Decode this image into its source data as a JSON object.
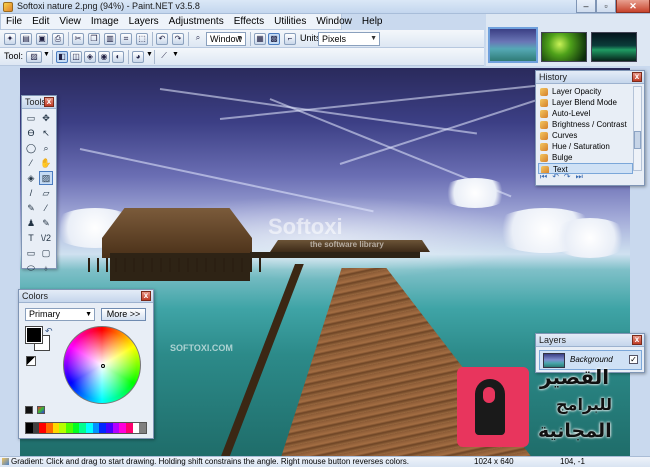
{
  "window": {
    "title": "Softoxi nature 2.png (94%) - Paint.NET v3.5.8",
    "minimize": "–",
    "maximize": "▫",
    "close": "✕"
  },
  "menu": [
    "File",
    "Edit",
    "View",
    "Image",
    "Layers",
    "Adjustments",
    "Effects",
    "Utilities",
    "Window",
    "Help"
  ],
  "toolbar": {
    "zoom_value": "Window",
    "units_label": "Units:",
    "units_value": "Pixels",
    "tool_label": "Tool:"
  },
  "canvas": {
    "watermark_main": "Softoxi",
    "watermark_sub": "the software library",
    "watermark_small": "SOFTOXI.COM"
  },
  "tools_panel": {
    "title": "Tools",
    "close": "x",
    "tools": [
      {
        "name": "rectangle-select-tool-icon",
        "glyph": "▭"
      },
      {
        "name": "move-selection-tool-icon",
        "glyph": "✥"
      },
      {
        "name": "lasso-select-tool-icon",
        "glyph": "ϴ"
      },
      {
        "name": "move-selected-tool-icon",
        "glyph": "↖"
      },
      {
        "name": "ellipse-select-tool-icon",
        "glyph": "◯"
      },
      {
        "name": "zoom-tool-icon",
        "glyph": "⌕"
      },
      {
        "name": "magic-wand-tool-icon",
        "glyph": "⁄"
      },
      {
        "name": "pan-tool-icon",
        "glyph": "✋"
      },
      {
        "name": "paint-bucket-tool-icon",
        "glyph": "◈"
      },
      {
        "name": "gradient-tool-icon",
        "glyph": "▨"
      },
      {
        "name": "paintbrush-tool-icon",
        "glyph": "/"
      },
      {
        "name": "eraser-tool-icon",
        "glyph": "▱"
      },
      {
        "name": "pencil-tool-icon",
        "glyph": "✎"
      },
      {
        "name": "color-picker-tool-icon",
        "glyph": "⁄"
      },
      {
        "name": "clone-stamp-tool-icon",
        "glyph": "♟"
      },
      {
        "name": "recolor-tool-icon",
        "glyph": "✎"
      },
      {
        "name": "text-tool-icon",
        "glyph": "T"
      },
      {
        "name": "line-curve-tool-icon",
        "glyph": "\\/2"
      },
      {
        "name": "rectangle-tool-icon",
        "glyph": "▭"
      },
      {
        "name": "rounded-rectangle-tool-icon",
        "glyph": "▢"
      },
      {
        "name": "ellipse-tool-icon",
        "glyph": "⬭"
      },
      {
        "name": "freeform-shape-tool-icon",
        "glyph": "♁"
      }
    ],
    "active_tool": 9
  },
  "colors_panel": {
    "title": "Colors",
    "close": "x",
    "mode": "Primary",
    "more_button": "More >>",
    "primary_color": "#000000",
    "secondary_color": "#ffffff",
    "palette": [
      "#000000",
      "#404040",
      "#ff0000",
      "#ff6a00",
      "#ffd800",
      "#b6ff00",
      "#4cff00",
      "#00ff21",
      "#00ff90",
      "#00ffff",
      "#0094ff",
      "#0026ff",
      "#4800ff",
      "#b200ff",
      "#ff00dc",
      "#ff006e",
      "#ffffff",
      "#808080"
    ]
  },
  "history_panel": {
    "title": "History",
    "close": "x",
    "items": [
      "Layer Opacity",
      "Layer Blend Mode",
      "Auto-Level",
      "Brightness / Contrast",
      "Curves",
      "Hue / Saturation",
      "Bulge",
      "Text"
    ],
    "selected_index": 7,
    "controls": [
      "⏮",
      "↶",
      "↷",
      "⏭"
    ]
  },
  "layers_panel": {
    "title": "Layers",
    "close": "x",
    "layer_name": "Background",
    "visible_check": "✓"
  },
  "overlay_logo": {
    "line1": "القصير",
    "line2": "للبرامج",
    "line3": "المجانية"
  },
  "status": {
    "message": "Gradient: Click and drag to start drawing. Holding shift constrains the angle. Right mouse button reverses colors.",
    "image_size": "1024 x 640",
    "cursor_position": "104, -1"
  },
  "colors": {
    "accent": "#6fa0dc",
    "logo_pink": "#e8355d"
  }
}
